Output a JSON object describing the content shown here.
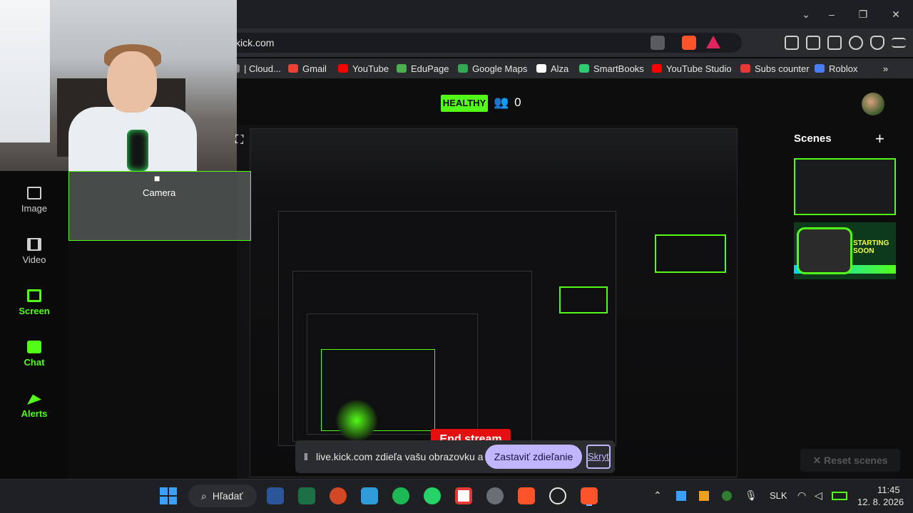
{
  "browser": {
    "url": "kick.com",
    "bookmarks": [
      {
        "label": "| Cloud...",
        "color": "#888888"
      },
      {
        "label": "Gmail",
        "color": "#ea4335"
      },
      {
        "label": "YouTube",
        "color": "#ff0000"
      },
      {
        "label": "EduPage",
        "color": "#4caf50"
      },
      {
        "label": "Google Maps",
        "color": "#34a853"
      },
      {
        "label": "Alza",
        "color": "#ffffff"
      },
      {
        "label": "SmartBooks",
        "color": "#2ecc71"
      },
      {
        "label": "YouTube Studio",
        "color": "#ff0000"
      },
      {
        "label": "Subs counter",
        "color": "#e53935"
      },
      {
        "label": "Roblox",
        "color": "#4a7cf7"
      }
    ],
    "bookmarks_more": "»",
    "window_buttons": {
      "minimize": "–",
      "restore": "❐",
      "close": "✕"
    }
  },
  "header": {
    "status": "HEALTHY",
    "viewer_count": "0"
  },
  "toolbar": {
    "items": [
      {
        "label": "Image",
        "icon": "image-icon"
      },
      {
        "label": "Video",
        "icon": "video-icon"
      },
      {
        "label": "Screen",
        "icon": "screen-icon"
      },
      {
        "label": "Chat",
        "icon": "chat-icon"
      },
      {
        "label": "Alerts",
        "icon": "alerts-icon"
      }
    ]
  },
  "camera": {
    "label": "Camera",
    "icon": "camera-icon"
  },
  "scenes": {
    "title": "Scenes",
    "add": "+",
    "scene2_text": "STARTING\nSOON",
    "reset_label": "✕ Reset scenes"
  },
  "preview": {
    "end_stream": "End stream"
  },
  "share": {
    "text": "live.kick.com zdieľa vašu obrazovku a zvuk.",
    "stop": "Zastaviť zdieľanie",
    "hide": "Skryť"
  },
  "taskbar": {
    "search": "Hľadať",
    "lang": "SLK",
    "time": "11:45",
    "date": "12. 8. 2026"
  },
  "colors": {
    "accent": "#53fc18",
    "danger": "#e41010",
    "share_btn": "#c2b5ff"
  }
}
